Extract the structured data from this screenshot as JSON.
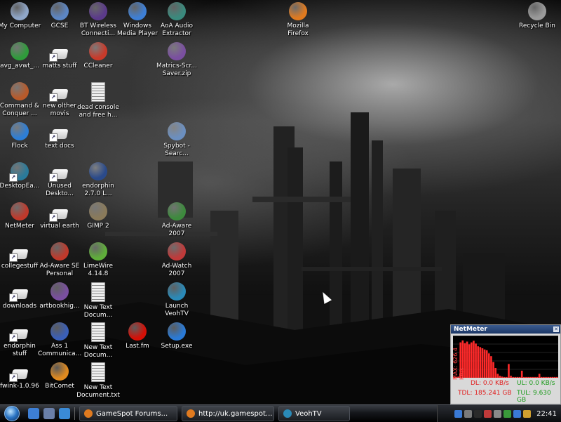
{
  "desktop": {
    "icons": [
      {
        "label": "My Computer",
        "icon": "computer-icon",
        "color": "#8fa6c8"
      },
      {
        "label": "GCSE",
        "icon": "monitor-icon",
        "color": "#5c86c4"
      },
      {
        "label": "BT Wireless Connecti...",
        "icon": "bt-wireless-icon",
        "color": "#5b3a8a"
      },
      {
        "label": "Windows Media Player",
        "icon": "media-player-icon",
        "color": "#3d7fd6"
      },
      {
        "label": "AoA Audio Extractor",
        "icon": "audio-extractor-icon",
        "color": "#3a8a7d"
      },
      {
        "label": "Mozilla Firefox",
        "icon": "firefox-icon",
        "color": "#e07a1f"
      },
      {
        "label": "Recycle Bin",
        "icon": "recycle-bin-icon",
        "color": "#9a9a9a"
      },
      {
        "label": "avg_avwt_...",
        "icon": "avg-icon",
        "color": "#2f9b3b"
      },
      {
        "label": "matts stuff",
        "icon": "folder-shortcut-icon",
        "color": "#dddddd"
      },
      {
        "label": "CCleaner",
        "icon": "ccleaner-icon",
        "color": "#c93a2a"
      },
      {
        "label": "Matrics-Scr... Saver.zip",
        "icon": "zip-archive-icon",
        "color": "#7a4fa0"
      },
      {
        "label": "Command & Conquer ...",
        "icon": "command-conquer-icon",
        "color": "#b85a2a"
      },
      {
        "label": "new olther movis",
        "icon": "folder-shortcut-icon",
        "color": "#dddddd"
      },
      {
        "label": "dead console and free h...",
        "icon": "text-document-icon",
        "color": "#efefef"
      },
      {
        "label": "Flock",
        "icon": "flock-icon",
        "color": "#2d7ed6"
      },
      {
        "label": "text docs",
        "icon": "folder-shortcut-icon",
        "color": "#dddddd"
      },
      {
        "label": "Spybot - Searc...",
        "icon": "spybot-icon",
        "color": "#6b8fc0"
      },
      {
        "label": "DesktopEa...",
        "icon": "desktop-ease-icon",
        "color": "#2a7a9a"
      },
      {
        "label": "Unused Deskto...",
        "icon": "folder-shortcut-icon",
        "color": "#dddddd"
      },
      {
        "label": "endorphin 2.7.0 L...",
        "icon": "endorphin-icon",
        "color": "#2a4a8a"
      },
      {
        "label": "NetMeter",
        "icon": "netmeter-icon",
        "color": "#c0392b"
      },
      {
        "label": "virtual earth",
        "icon": "folder-shortcut-icon",
        "color": "#dddddd"
      },
      {
        "label": "GIMP 2",
        "icon": "gimp-icon",
        "color": "#8a7a5a"
      },
      {
        "label": "Ad-Aware 2007",
        "icon": "ad-aware-icon",
        "color": "#3d8a3d"
      },
      {
        "label": "collegestuff",
        "icon": "folder-shortcut-icon",
        "color": "#dddddd"
      },
      {
        "label": "Ad-Aware SE Personal",
        "icon": "ad-aware-se-icon",
        "color": "#c0392b"
      },
      {
        "label": "LimeWire 4.14.8",
        "icon": "limewire-icon",
        "color": "#5fae3a"
      },
      {
        "label": "Ad-Watch 2007",
        "icon": "ad-watch-icon",
        "color": "#c03a3a"
      },
      {
        "label": "downloads",
        "icon": "folder-shortcut-icon",
        "color": "#dddddd"
      },
      {
        "label": "artbookhig...",
        "icon": "zip-archive-icon",
        "color": "#7a4fa0"
      },
      {
        "label": "New Text Docum...",
        "icon": "text-document-icon",
        "color": "#efefef"
      },
      {
        "label": "Launch VeohTV",
        "icon": "veohtv-icon",
        "color": "#2a8ab8"
      },
      {
        "label": "endorphin stuff",
        "icon": "folder-shortcut-icon",
        "color": "#dddddd"
      },
      {
        "label": "Ass 1 Communica...",
        "icon": "word-document-icon",
        "color": "#3a5fb8"
      },
      {
        "label": "New Text Docum...",
        "icon": "text-document-icon",
        "color": "#efefef"
      },
      {
        "label": "Last.fm",
        "icon": "lastfm-icon",
        "color": "#d51007"
      },
      {
        "label": "Setup.exe",
        "icon": "setup-exe-icon",
        "color": "#2a7ad6"
      },
      {
        "label": "fwink-1.0.96",
        "icon": "folder-shortcut-icon",
        "color": "#dddddd"
      },
      {
        "label": "BitComet",
        "icon": "bitcomet-icon",
        "color": "#e08a1f"
      },
      {
        "label": "New Text Document.txt",
        "icon": "text-document-icon",
        "color": "#efefef"
      }
    ]
  },
  "taskbar": {
    "quick_launch": [
      {
        "icon": "media-player-icon",
        "color": "#3d7fd6"
      },
      {
        "icon": "show-desktop-icon",
        "color": "#6a7fa8"
      },
      {
        "icon": "internet-explorer-icon",
        "color": "#3a8ad6"
      }
    ],
    "tasks": [
      {
        "label": "GameSpot Forums...",
        "icon": "firefox-icon",
        "color": "#e07a1f"
      },
      {
        "label": "http://uk.gamespot...",
        "icon": "firefox-icon",
        "color": "#e07a1f"
      },
      {
        "label": "VeohTV",
        "icon": "veohtv-icon",
        "color": "#2a8ab8"
      }
    ],
    "tray_icons": [
      {
        "icon": "tray-app-icon",
        "color": "#3a7ad6"
      },
      {
        "icon": "tray-network-icon",
        "color": "#7a7a7a"
      },
      {
        "icon": "tray-zonealarm-icon",
        "color": "#2a2a2a"
      },
      {
        "icon": "tray-shield-icon",
        "color": "#c03a3a"
      },
      {
        "icon": "tray-volume-icon",
        "color": "#8a8a8a"
      },
      {
        "icon": "tray-wifi-icon",
        "color": "#3a9a3a"
      },
      {
        "icon": "tray-sync-icon",
        "color": "#3a7ad6"
      },
      {
        "icon": "tray-security-icon",
        "color": "#d0a030"
      }
    ],
    "clock": "22:41"
  },
  "netmeter": {
    "title": "NetMeter",
    "max_label": "MAX: 626.4 KB/s",
    "dl": "DL: 0.0 KB/s",
    "ul": "UL: 0.0 KB/s",
    "tdl": "TDL: 185.241 GB",
    "tul": "TUL: 9.630 GB",
    "dl_color": "#ff2a2a",
    "ul_color": "#2aff2a",
    "dl_samples": [
      0.02,
      0.02,
      0.03,
      0.9,
      0.95,
      0.88,
      0.92,
      0.85,
      0.9,
      0.94,
      0.87,
      0.8,
      0.78,
      0.75,
      0.72,
      0.7,
      0.62,
      0.55,
      0.4,
      0.25,
      0.1,
      0.05,
      0.03,
      0.02,
      0.02,
      0.35,
      0.05,
      0.02,
      0.02,
      0.02,
      0.02,
      0.18,
      0.02,
      0.02,
      0.02,
      0.02,
      0.02,
      0.02,
      0.02,
      0.1,
      0.02,
      0.02,
      0.02,
      0.02,
      0.02,
      0.02,
      0.02,
      0.02
    ]
  }
}
